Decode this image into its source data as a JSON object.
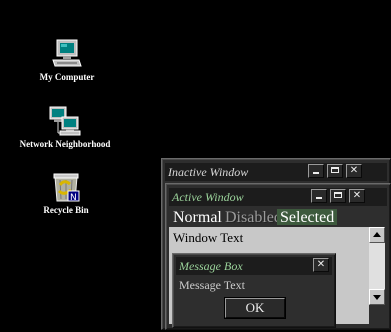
{
  "desktop": {
    "icons": [
      {
        "label": "My Computer",
        "icon": "computer-icon"
      },
      {
        "label": "Network Neighborhood",
        "icon": "network-icon"
      },
      {
        "label": "Recycle Bin",
        "icon": "recycle-bin-icon"
      }
    ]
  },
  "inactive_window": {
    "title": "Inactive Window"
  },
  "active_window": {
    "title": "Active Window",
    "menu": [
      {
        "label": "Normal",
        "state": "normal"
      },
      {
        "label": "Disabled",
        "state": "disabled"
      },
      {
        "label": "Selected",
        "state": "selected"
      }
    ],
    "content_text": "Window Text"
  },
  "message_box": {
    "title": "Message Box",
    "text": "Message Text",
    "ok_label": "OK"
  },
  "colors": {
    "desktop": "#000000",
    "title_active_text": "#9bd39b",
    "selected_menu_bg": "#3d5a3d",
    "window_bg": "#c8c8c8"
  }
}
